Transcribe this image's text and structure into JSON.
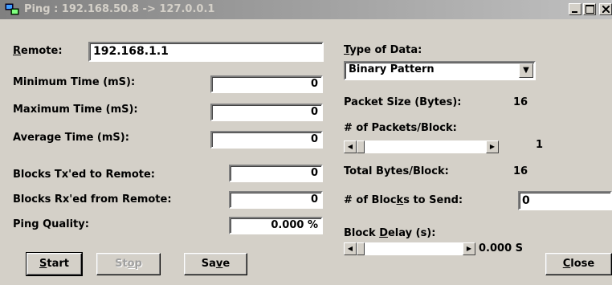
{
  "window": {
    "title": "Ping : 192.168.50.8 -> 127.0.0.1"
  },
  "left": {
    "remote_label": "Remote:",
    "remote_value": "192.168.1.1",
    "min_time_label": "Minimum Time (mS):",
    "min_time_value": "0",
    "max_time_label": "Maximum Time (mS):",
    "max_time_value": "0",
    "avg_time_label": "Average Time (mS):",
    "avg_time_value": "0",
    "blocks_tx_label": "Blocks Tx'ed to Remote:",
    "blocks_tx_value": "0",
    "blocks_rx_label": "Blocks Rx'ed from Remote:",
    "blocks_rx_value": "0",
    "quality_label": "Ping Quality:",
    "quality_value": "0.000 %"
  },
  "right": {
    "type_label": "Type of Data:",
    "type_value": "Binary Pattern",
    "packet_size_label": "Packet Size (Bytes):",
    "packet_size_value": "16",
    "packets_label": "# of Packets/Block:",
    "packets_value": "1",
    "total_bytes_label": "Total Bytes/Block:",
    "total_bytes_value": "16",
    "blocks_send_label": "# of Blocks to Send:",
    "blocks_send_value": "0",
    "delay_label": "Block Delay (s):",
    "delay_value": "0.000 S"
  },
  "buttons": {
    "start": "Start",
    "stop": "Stop",
    "save": "Save",
    "close": "Close"
  },
  "icons": {
    "scroll_left": "◀",
    "scroll_right": "▶",
    "dropdown": "▼"
  }
}
